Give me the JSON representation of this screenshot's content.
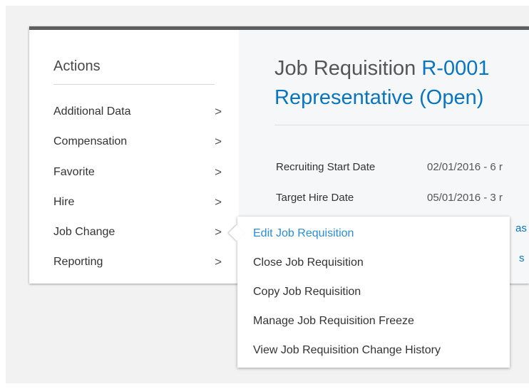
{
  "actions": {
    "title": "Actions",
    "items": [
      {
        "label": "Additional Data",
        "chevron": ">"
      },
      {
        "label": "Compensation",
        "chevron": ">"
      },
      {
        "label": "Favorite",
        "chevron": ">"
      },
      {
        "label": "Hire",
        "chevron": ">"
      },
      {
        "label": "Job Change",
        "chevron": ">"
      },
      {
        "label": "Reporting",
        "chevron": ">"
      }
    ]
  },
  "header": {
    "prefix": "Job Requisition",
    "id_link": "R-0001",
    "title_link_line2": "Representative (Open)"
  },
  "fields": {
    "recruiting_start_label": "Recruiting Start Date",
    "recruiting_start_value": "02/01/2016 - 6 r",
    "target_hire_label": "Target Hire Date",
    "target_hire_value": "05/01/2016 - 3 r",
    "partial_link_1": "as",
    "partial_link_2": "s"
  },
  "submenu": {
    "items": [
      {
        "label": "Edit Job Requisition",
        "active": true
      },
      {
        "label": "Close Job Requisition"
      },
      {
        "label": "Copy Job Requisition"
      },
      {
        "label": "Manage Job Requisition Freeze"
      },
      {
        "label": "View Job Requisition Change History"
      }
    ]
  },
  "colors": {
    "link": "#0875c1",
    "active_menu": "#2a8ed6",
    "topbar": "#5e5e5e"
  }
}
